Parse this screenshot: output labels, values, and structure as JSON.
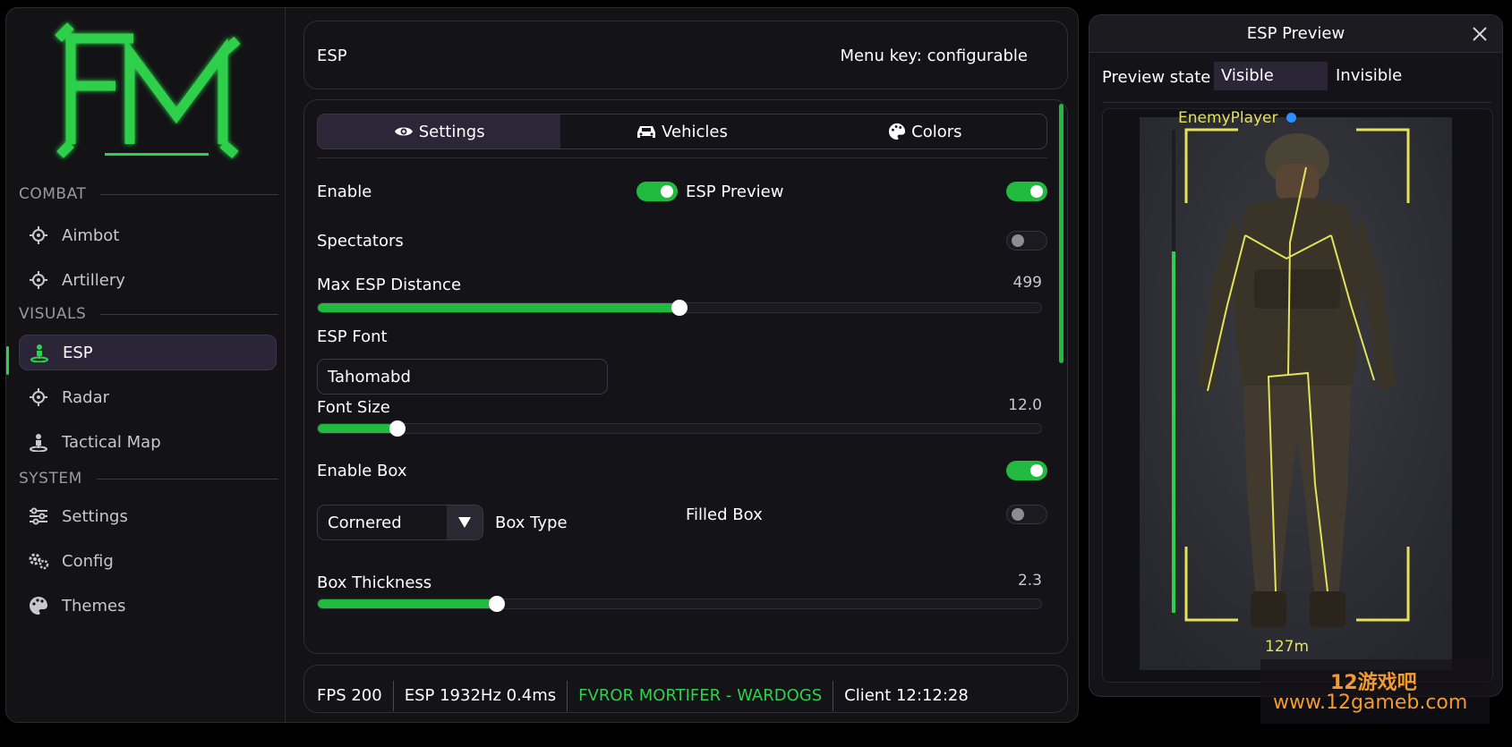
{
  "logo": {
    "text": "FM",
    "color": "#2fd04b"
  },
  "sidebar": {
    "sections": [
      {
        "title": "COMBAT"
      },
      {
        "title": "VISUALS"
      },
      {
        "title": "SYSTEM"
      }
    ],
    "items": [
      {
        "label": "Aimbot",
        "icon": "crosshair-icon"
      },
      {
        "label": "Artillery",
        "icon": "crosshair-icon"
      },
      {
        "label": "ESP",
        "icon": "person-pin-icon",
        "active": true
      },
      {
        "label": "Radar",
        "icon": "crosshair-icon"
      },
      {
        "label": "Tactical Map",
        "icon": "person-pin-icon"
      },
      {
        "label": "Settings",
        "icon": "sliders-icon"
      },
      {
        "label": "Config",
        "icon": "gears-icon"
      },
      {
        "label": "Themes",
        "icon": "palette-icon"
      }
    ]
  },
  "header": {
    "title": "ESP",
    "menu_key": "Menu key: configurable"
  },
  "tabs": [
    {
      "label": "Settings",
      "icon": "eye-icon",
      "active": true
    },
    {
      "label": "Vehicles",
      "icon": "car-icon"
    },
    {
      "label": "Colors",
      "icon": "palette-icon"
    }
  ],
  "settings": {
    "enable": {
      "label": "Enable",
      "on": true
    },
    "esp_preview": {
      "label": "ESP Preview",
      "on": true
    },
    "spectators": {
      "label": "Spectators",
      "on": false
    },
    "max_distance": {
      "label": "Max ESP Distance",
      "value": "499",
      "fraction": 0.5
    },
    "esp_font": {
      "label": "ESP Font",
      "value": "Tahomabd"
    },
    "font_size": {
      "label": "Font Size",
      "value": "12.0",
      "fraction": 0.11
    },
    "enable_box": {
      "label": "Enable Box",
      "on": true
    },
    "box_type": {
      "label": "Box Type",
      "value": "Cornered"
    },
    "filled_box": {
      "label": "Filled Box",
      "on": false
    },
    "box_thickness": {
      "label": "Box Thickness",
      "value": "2.3",
      "fraction": 0.247
    }
  },
  "status": {
    "fps": "FPS 200",
    "esp": "ESP 1932Hz 0.4ms",
    "name": "FVROR MORTIFER - WARDOGS",
    "client": "Client 12:12:28"
  },
  "preview": {
    "title": "ESP Preview",
    "state_label": "Preview state",
    "states": [
      "Visible",
      "Invisible"
    ],
    "enemy_name": "EnemyPlayer",
    "distance": "127m",
    "box_color": "#e4e25a"
  },
  "watermark": {
    "line1": "12游戏吧",
    "line2": "www.12gameb.com"
  },
  "colors": {
    "accent": "#2fd04b",
    "esp": "#e4e25a",
    "bg": "#131215"
  }
}
